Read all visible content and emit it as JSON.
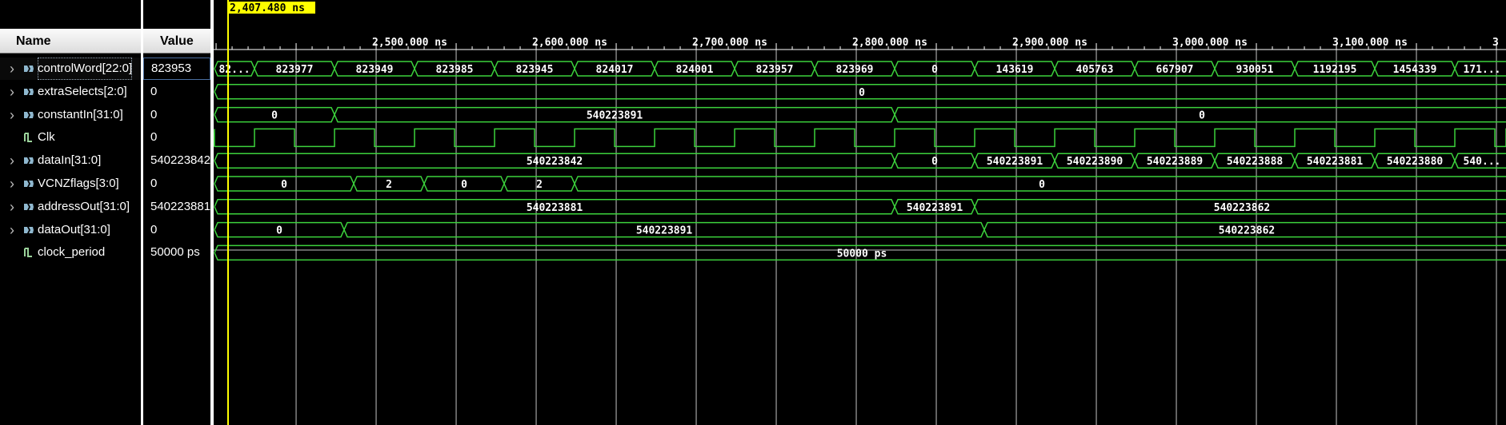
{
  "cursor": {
    "time_label": "2,407.480 ns"
  },
  "headers": {
    "name": "Name",
    "value": "Value"
  },
  "signals": [
    {
      "name": "controlWord[22:0]",
      "value": "823953",
      "icon": "bus-signal-icon",
      "expandable": true
    },
    {
      "name": "extraSelects[2:0]",
      "value": "0",
      "icon": "bus-signal-icon",
      "expandable": true
    },
    {
      "name": "constantIn[31:0]",
      "value": "0",
      "icon": "bus-signal-icon",
      "expandable": true
    },
    {
      "name": "Clk",
      "value": "0",
      "icon": "bit-signal-icon",
      "expandable": false
    },
    {
      "name": "dataIn[31:0]",
      "value": "540223842",
      "icon": "bus-signal-icon",
      "expandable": true
    },
    {
      "name": "VCNZflags[3:0]",
      "value": "0",
      "icon": "bus-signal-icon",
      "expandable": true
    },
    {
      "name": "addressOut[31:0]",
      "value": "540223881",
      "icon": "bus-signal-icon",
      "expandable": true
    },
    {
      "name": "dataOut[31:0]",
      "value": "0",
      "icon": "bus-signal-icon",
      "expandable": true
    },
    {
      "name": "clock_period",
      "value": "50000 ps",
      "icon": "bit-signal-icon",
      "expandable": false
    }
  ],
  "timeline": {
    "view_start_ns": 2407.48,
    "view_end_ns": 2802.4,
    "ticks_ns": [
      2500,
      2600,
      2700,
      2800,
      2900,
      3000,
      3100,
      3200
    ],
    "tick_labels": [
      "2,500.000 ns",
      "2,600.000 ns",
      "2,700.000 ns",
      "2,800.000 ns",
      "2,900.000 ns",
      "3,000.000 ns",
      "3,100.000 ns",
      "3"
    ],
    "clock_period_ns": 50
  },
  "waveforms": {
    "controlWord": {
      "times": [
        2399,
        2424,
        2474,
        2524,
        2574,
        2624,
        2674,
        2724,
        2774,
        2824,
        2874,
        2924,
        2974,
        3024,
        3074,
        3124,
        3174
      ],
      "labels": [
        "82...",
        "823977",
        "823949",
        "823985",
        "823945",
        "824017",
        "824001",
        "823957",
        "823969",
        "0",
        "143619",
        "405763",
        "667907",
        "930051",
        "1192195",
        "1454339",
        "171..."
      ]
    },
    "extraSelects": {
      "times": [
        2399
      ],
      "labels": [
        "0"
      ]
    },
    "constantIn": {
      "times": [
        2399,
        2474,
        2824
      ],
      "labels": [
        "0",
        "540223891",
        "0"
      ]
    },
    "Clk": {
      "first_rise_ns": 2424,
      "period_ns": 50,
      "low_at_start": true
    },
    "dataIn": {
      "times": [
        2399,
        2824,
        2874,
        2924,
        2974,
        3024,
        3074,
        3124,
        3174
      ],
      "labels": [
        "540223842",
        "0",
        "540223891",
        "540223890",
        "540223889",
        "540223888",
        "540223881",
        "540223880",
        "540..."
      ]
    },
    "VCNZflags": {
      "times": [
        2399,
        2486,
        2530,
        2580,
        2624
      ],
      "labels": [
        "0",
        "2",
        "0",
        "2",
        "0"
      ]
    },
    "addressOut": {
      "times": [
        2399,
        2824,
        2874
      ],
      "labels": [
        "540223881",
        "540223891",
        "540223862"
      ]
    },
    "dataOut": {
      "times": [
        2399,
        2480,
        2880
      ],
      "labels": [
        "0",
        "540223891",
        "540223862"
      ]
    },
    "clock_period": {
      "times": [
        2399
      ],
      "labels": [
        "50000 ps"
      ]
    }
  },
  "colors": {
    "wave": "#3cd23c",
    "cursor": "#ffff00",
    "grid": "#e6e6e6",
    "axis": "#ffffff",
    "background": "#000000"
  }
}
